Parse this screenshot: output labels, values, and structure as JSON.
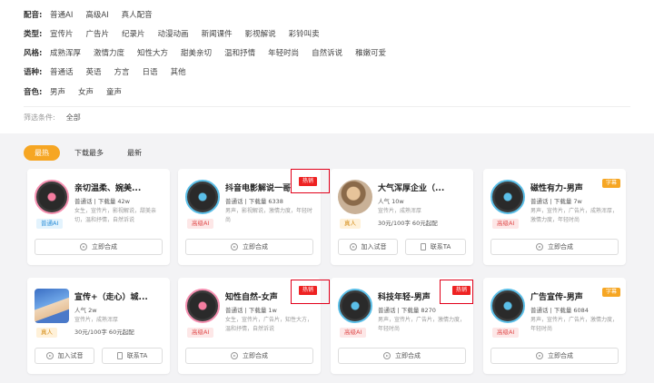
{
  "filters": [
    {
      "label": "配音:",
      "options": [
        "普通AI",
        "高级AI",
        "真人配音"
      ]
    },
    {
      "label": "类型:",
      "options": [
        "宣传片",
        "广告片",
        "纪录片",
        "动漫动画",
        "新闻课件",
        "影视解说",
        "彩铃叫卖"
      ]
    },
    {
      "label": "风格:",
      "options": [
        "成熟浑厚",
        "激情力度",
        "知性大方",
        "甜美亲切",
        "温和抒情",
        "年轻时尚",
        "自然诉说",
        "稚嫩可爱"
      ]
    },
    {
      "label": "语种:",
      "options": [
        "普通话",
        "英语",
        "方言",
        "日语",
        "其他"
      ]
    },
    {
      "label": "音色:",
      "options": [
        "男声",
        "女声",
        "童声"
      ]
    }
  ],
  "filter_condition": {
    "label": "筛选条件:",
    "value": "全部"
  },
  "sort_tabs": [
    "最热",
    "下载最多",
    "最新"
  ],
  "cards": [
    {
      "title": "亲切温柔、婉美...",
      "subline": "普通话 | 下载量 42w",
      "desc": "女生，宣传片，影视解说，甜美亲切，温和抒情，自然诉说",
      "badge": "普通AI"
    },
    {
      "title": "抖音电影解说一哥",
      "subline": "普通话 | 下载量 6338",
      "desc": "男声，影视解说，激情力度，年轻时尚",
      "badge": "高级AI",
      "hot": "热销"
    },
    {
      "title": "大气浑厚企业（...",
      "subline": "人气 10w",
      "desc": "宣传片，成熟浑厚",
      "price": "30元/100字 60元起配",
      "badge": "真人",
      "btn1": "加入试音",
      "btn2": "联系TA"
    },
    {
      "title": "磁性有力-男声",
      "subline": "普通话 | 下载量 7w",
      "desc": "男声，宣传片，广告片，成熟浑厚，激情力度，年轻时尚",
      "badge": "高级AI",
      "corner": "字幕"
    },
    {
      "title": "宣传+（走心）城...",
      "subline": "人气 2w",
      "desc": "宣传片，成熟浑厚",
      "price": "30元/100字 60元起配",
      "badge": "真人",
      "btn1": "加入试音",
      "btn2": "联系TA"
    },
    {
      "title": "知性自然-女声",
      "subline": "普通话 | 下载量 1w",
      "desc": "女生，宣传片，广告片，知性大方，温和抒情，自然诉说",
      "badge": "高级AI",
      "hot": "热销"
    },
    {
      "title": "科技年轻-男声",
      "subline": "普通话 | 下载量 8270",
      "desc": "男声，宣传片，广告片，激情力度，年轻时尚",
      "badge": "高级AI",
      "hot": "热销"
    },
    {
      "title": "广告宣传-男声",
      "subline": "普通话 | 下载量 6084",
      "desc": "男声，宣传片，广告片，激情力度，年轻时尚",
      "badge": "高级AI",
      "corner": "字幕"
    }
  ],
  "synth_button": "立即合成"
}
